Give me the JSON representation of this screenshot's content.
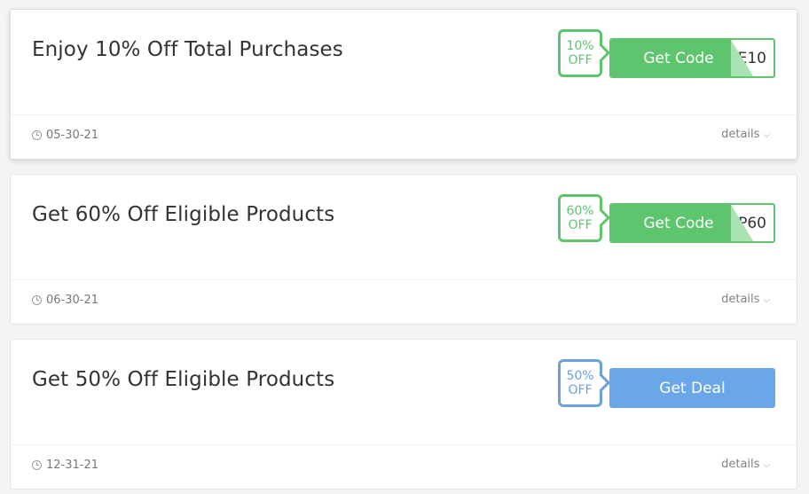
{
  "colors": {
    "code_green": "#5ec46e",
    "deal_blue": "#6aa7e8"
  },
  "offers": [
    {
      "title": "Enjoy 10% Off Total Purchases",
      "badge_top": "10%",
      "badge_bottom": "OFF",
      "button_label": "Get Code",
      "code_peek": "E10",
      "date": "05-30-21",
      "details_label": "details"
    },
    {
      "title": "Get 60% Off Eligible Products",
      "badge_top": "60%",
      "badge_bottom": "OFF",
      "button_label": "Get Code",
      "code_peek": "P60",
      "date": "06-30-21",
      "details_label": "details"
    },
    {
      "title": "Get 50% Off Eligible Products",
      "badge_top": "50%",
      "badge_bottom": "OFF",
      "button_label": "Get Deal",
      "date": "12-31-21",
      "details_label": "details"
    }
  ]
}
